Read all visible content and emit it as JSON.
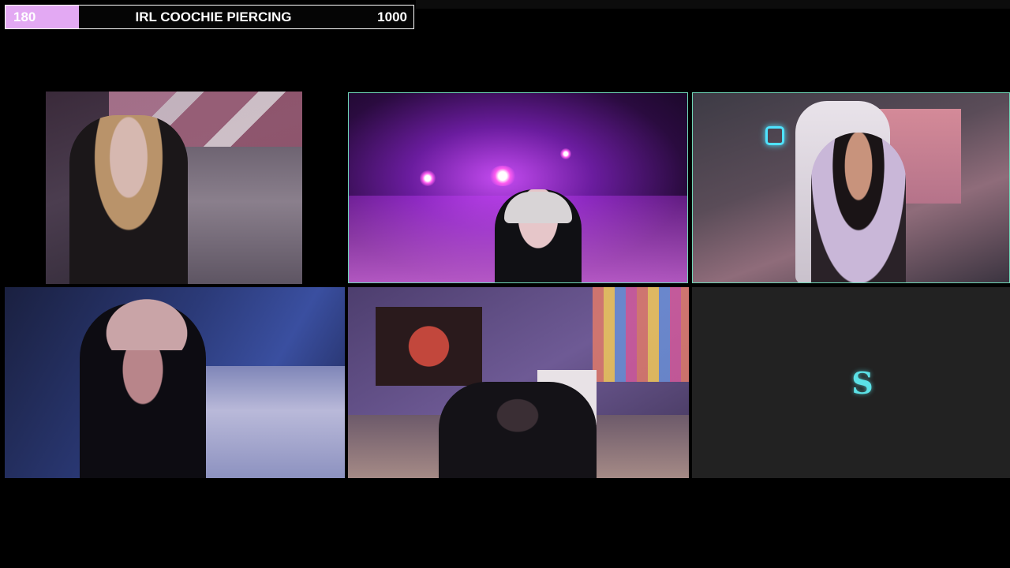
{
  "goal": {
    "current": "180",
    "title": "IRL COOCHIE PIERCING",
    "target": "1000",
    "progress_fraction": 0.18,
    "fill_color": "#e3a9f3"
  },
  "tiles": [
    {
      "id": "cam-1",
      "active": false
    },
    {
      "id": "cam-2",
      "active": true
    },
    {
      "id": "cam-3",
      "active": true
    },
    {
      "id": "cam-4",
      "active": false
    },
    {
      "id": "cam-5",
      "active": false
    },
    {
      "id": "cam-6-empty",
      "active": false
    }
  ],
  "placeholder": {
    "logo_glyph": "S",
    "logo_color": "#5be1e6",
    "icon": "s-logo-icon"
  },
  "colors": {
    "background": "#000000",
    "active_border": "#6fd6b6",
    "empty_tile": "#222222"
  }
}
